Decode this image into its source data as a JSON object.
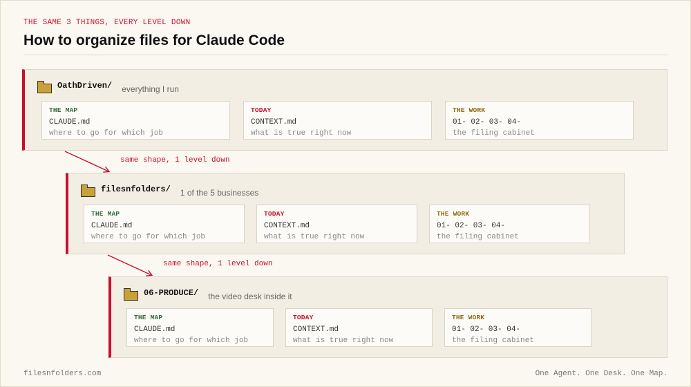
{
  "header": {
    "eyebrow": "THE SAME 3 THINGS, EVERY LEVEL DOWN",
    "title": "How to organize files for Claude Code"
  },
  "levels": [
    {
      "folder": "OathDriven/",
      "description": "everything I run",
      "cards": [
        {
          "label": "THE MAP",
          "file": "CLAUDE.md",
          "note": "where to go for which job"
        },
        {
          "label": "TODAY",
          "file": "CONTEXT.md",
          "note": "what is true right now"
        },
        {
          "label": "THE WORK",
          "file": "01- 02- 03- 04-",
          "note": "the filing cabinet"
        }
      ]
    },
    {
      "folder": "filesnfolders/",
      "description": "1 of the 5 businesses",
      "cards": [
        {
          "label": "THE MAP",
          "file": "CLAUDE.md",
          "note": "where to go for which job"
        },
        {
          "label": "TODAY",
          "file": "CONTEXT.md",
          "note": "what is true right now"
        },
        {
          "label": "THE WORK",
          "file": "01- 02- 03- 04-",
          "note": "the filing cabinet"
        }
      ]
    },
    {
      "folder": "06-PRODUCE/",
      "description": "the video desk inside it",
      "cards": [
        {
          "label": "THE MAP",
          "file": "CLAUDE.md",
          "note": "where to go for which job"
        },
        {
          "label": "TODAY",
          "file": "CONTEXT.md",
          "note": "what is true right now"
        },
        {
          "label": "THE WORK",
          "file": "01- 02- 03- 04-",
          "note": "the filing cabinet"
        }
      ]
    }
  ],
  "connectors": [
    {
      "text": "same shape, 1 level down"
    },
    {
      "text": "same shape, 1 level down"
    }
  ],
  "footer": {
    "left": "filesnfolders.com",
    "right": "One Agent. One Desk. One Map."
  },
  "colors": {
    "accent": "#c8102e",
    "map_label": "#2e6b3a",
    "work_label": "#8a6a10",
    "folder": "#c9a13b",
    "panel": "#f2eee3",
    "background": "#faf8f1"
  },
  "icons": {
    "folder": "folder-icon",
    "connector": "arrow-down-right-icon"
  }
}
